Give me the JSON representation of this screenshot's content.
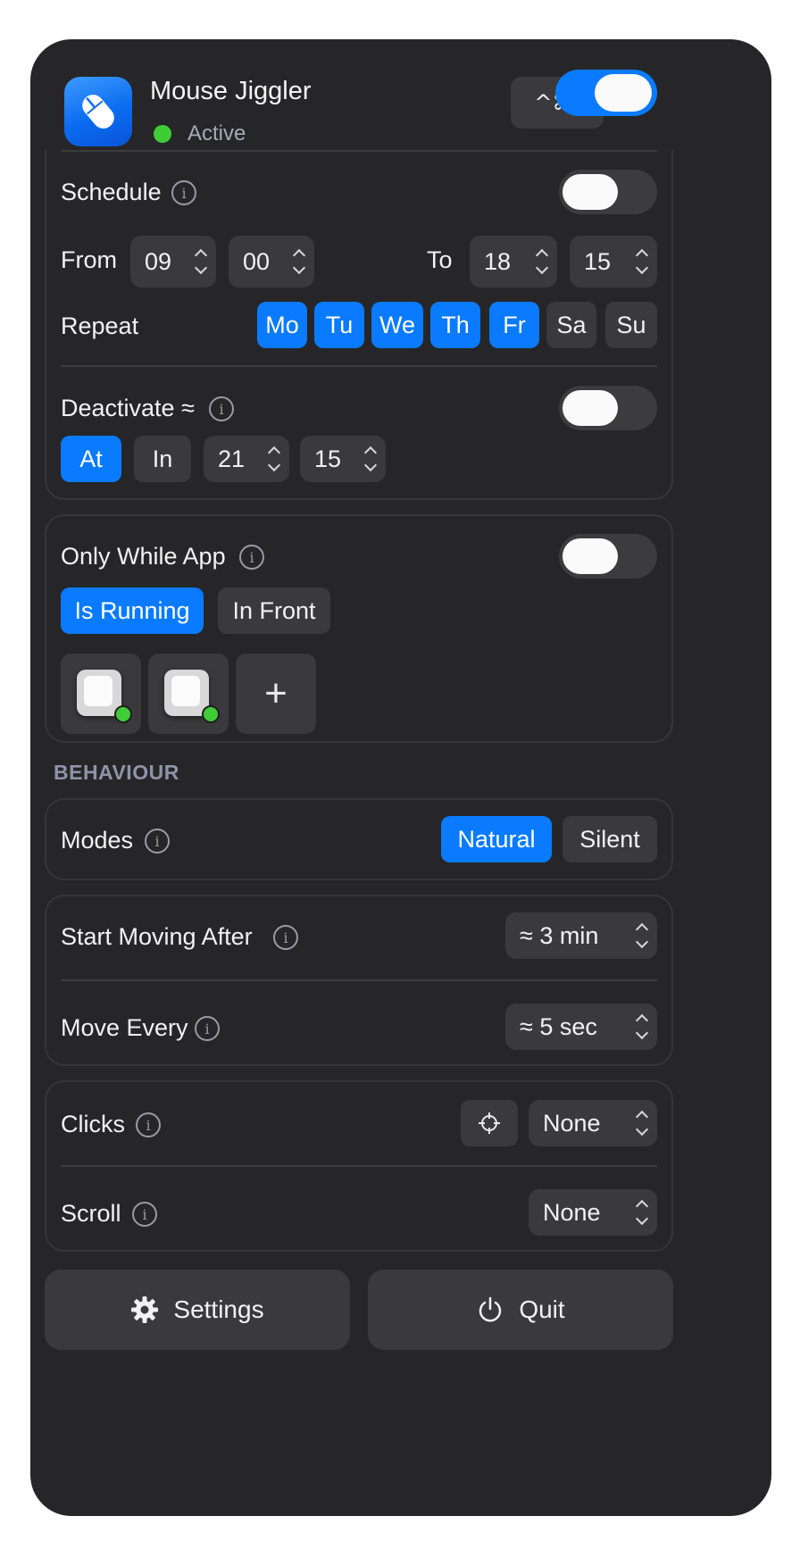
{
  "header": {
    "title": "Mouse Jiggler",
    "status": "Active",
    "shortcut": "^⌘J",
    "master_toggle_on": true,
    "icon": "mouse-icon"
  },
  "schedule": {
    "label": "Schedule",
    "enabled": false,
    "from_label": "From",
    "from_hour": "09",
    "from_minute": "00",
    "to_label": "To",
    "to_hour": "18",
    "to_minute": "15",
    "repeat_label": "Repeat",
    "days": [
      {
        "label": "Mo",
        "selected": true
      },
      {
        "label": "Tu",
        "selected": true
      },
      {
        "label": "We",
        "selected": true
      },
      {
        "label": "Th",
        "selected": true
      },
      {
        "label": "Fr",
        "selected": true
      },
      {
        "label": "Sa",
        "selected": false
      },
      {
        "label": "Su",
        "selected": false
      }
    ]
  },
  "deactivate": {
    "label": "Deactivate ≈",
    "enabled": false,
    "at_label": "At",
    "in_label": "In",
    "hour": "21",
    "minute": "15"
  },
  "only_while_app": {
    "label": "Only While App",
    "enabled": false,
    "is_running_label": "Is Running",
    "in_front_label": "In Front",
    "add_label": "+"
  },
  "behaviour": {
    "section_title": "BEHAVIOUR",
    "modes_label": "Modes",
    "natural_label": "Natural",
    "silent_label": "Silent",
    "start_moving_label": "Start Moving After",
    "start_moving_value": "≈ 3 min",
    "move_every_label": "Move Every",
    "move_every_value": "≈ 5 sec",
    "clicks_label": "Clicks",
    "clicks_value": "None",
    "scroll_label": "Scroll",
    "scroll_value": "None"
  },
  "footer": {
    "settings_label": "Settings",
    "quit_label": "Quit"
  },
  "colors": {
    "accent": "#0a7bff",
    "panel": "#262628",
    "control": "#3a3a3c",
    "active_dot": "#3fcd37"
  }
}
